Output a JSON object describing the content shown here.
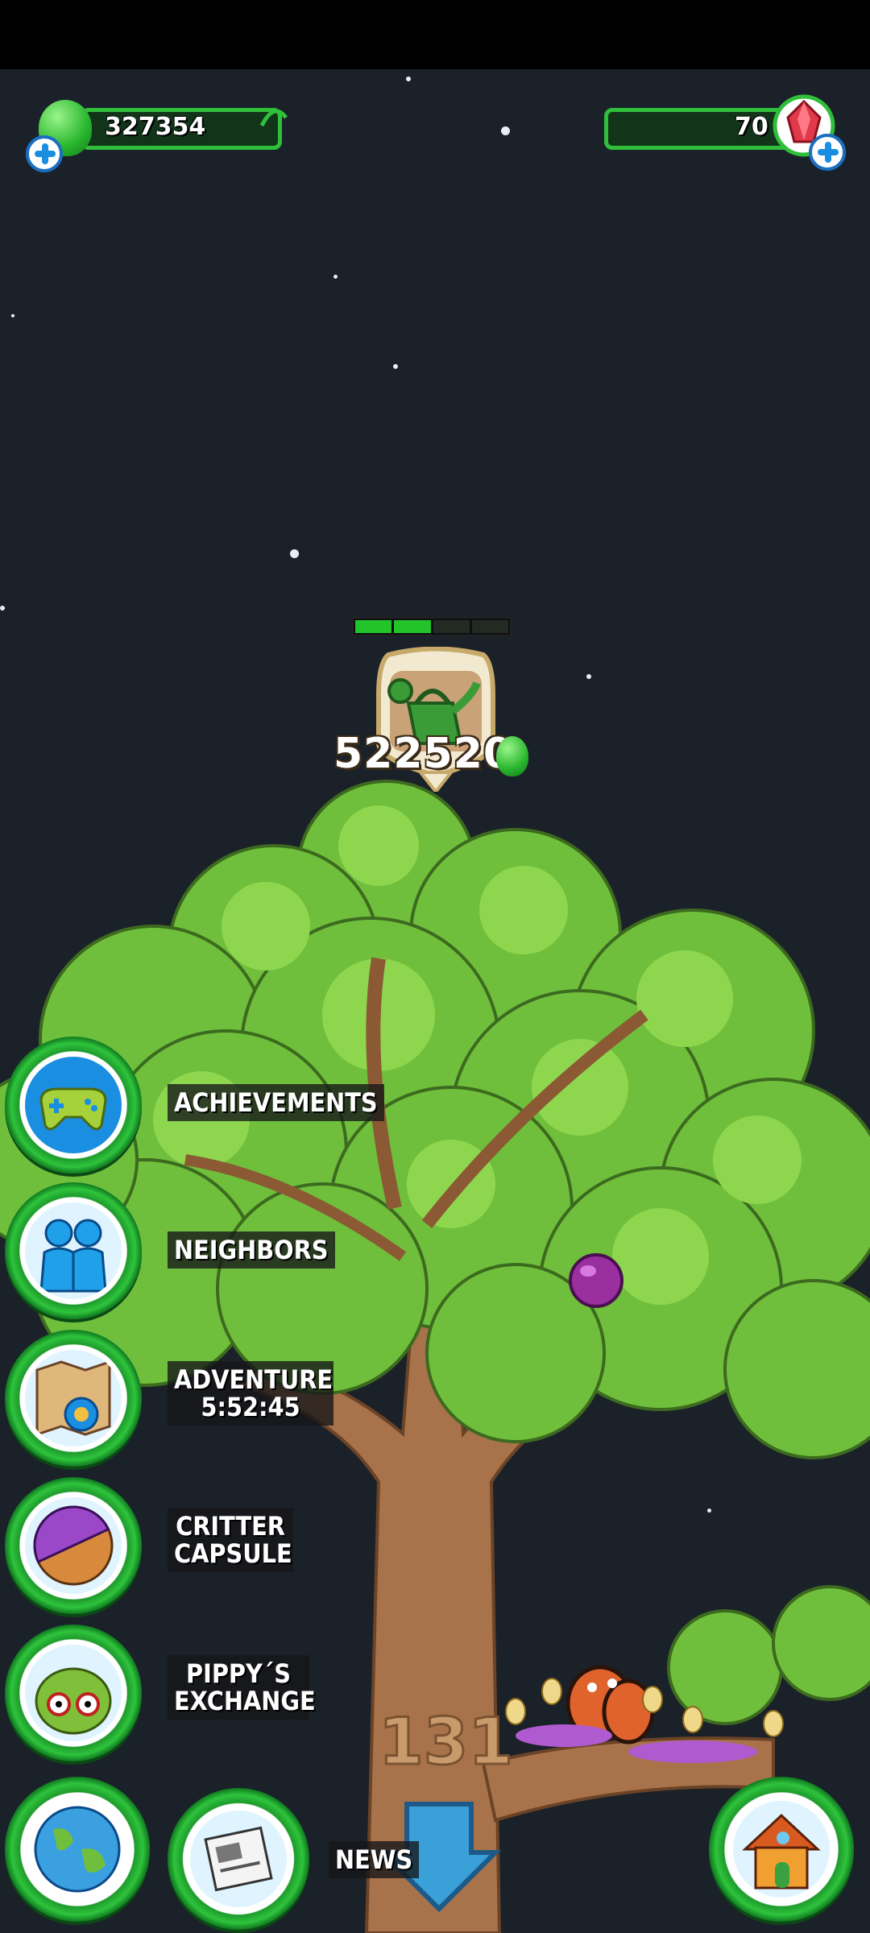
{
  "hud": {
    "green_gems": "327354",
    "red_gems": "70"
  },
  "tree": {
    "water_progress_segments_filled": 2,
    "water_progress_segments_total": 4,
    "score": "522520",
    "level_carving": "131"
  },
  "menu": {
    "achievements": "ACHIEVEMENTS",
    "neighbors": "NEIGHBORS",
    "adventure_line1": "ADVENTURE",
    "adventure_timer": "5:52:45",
    "critter_line1": "CRITTER",
    "critter_line2": "CAPSULE",
    "pippy_line1": "PIPPY´S",
    "pippy_line2": "EXCHANGE",
    "news": "NEWS"
  },
  "icons": [
    "green-gem-icon",
    "red-gem-icon",
    "plus-icon",
    "watering-can-icon",
    "gamepad-icon",
    "neighbors-icon",
    "map-compass-icon",
    "capsule-icon",
    "pippy-icon",
    "globe-icon",
    "newspaper-icon",
    "down-arrow-icon",
    "house-icon"
  ]
}
